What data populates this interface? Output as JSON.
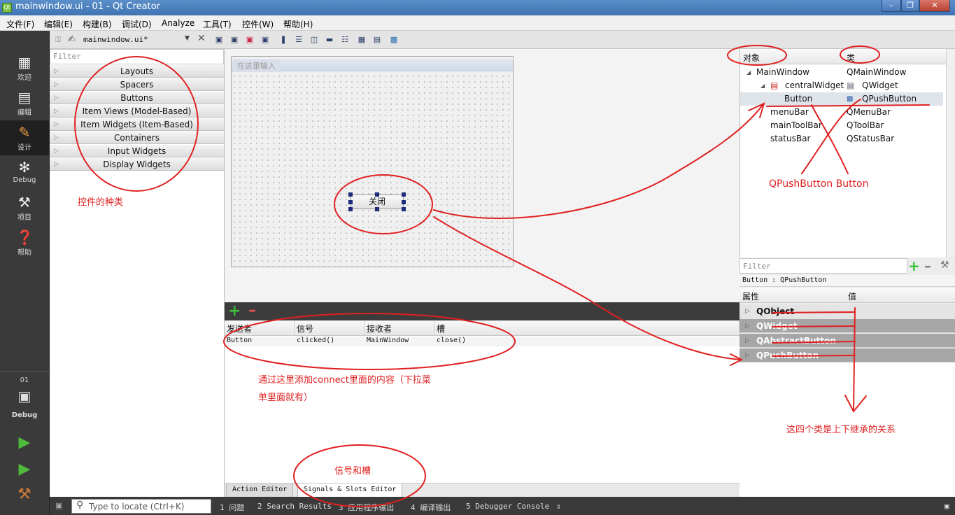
{
  "window": {
    "title": "mainwindow.ui - 01 - Qt Creator",
    "app_icon": "Qt"
  },
  "menubar": [
    "文件(F)",
    "编辑(E)",
    "构建(B)",
    "调试(D)",
    "Analyze",
    "工具(T)",
    "控件(W)",
    "帮助(H)"
  ],
  "modes": [
    {
      "label": "欢迎",
      "icon": "grid-icon"
    },
    {
      "label": "编辑",
      "icon": "document-icon"
    },
    {
      "label": "设计",
      "icon": "pencil-icon"
    },
    {
      "label": "Debug",
      "icon": "bug-icon"
    },
    {
      "label": "项目",
      "icon": "wrench-icon"
    },
    {
      "label": "帮助",
      "icon": "help-icon"
    }
  ],
  "kit": {
    "project": "01",
    "build": "Debug"
  },
  "editor": {
    "filename": "mainwindow.ui*"
  },
  "widgetbox": {
    "filter_placeholder": "Filter",
    "categories": [
      "Layouts",
      "Spacers",
      "Buttons",
      "Item Views (Model-Based)",
      "Item Widgets (Item-Based)",
      "Containers",
      "Input Widgets",
      "Display Widgets"
    ]
  },
  "form": {
    "toolbar_placeholder": "在这里输入",
    "button_text": "关闭"
  },
  "signals": {
    "headers": [
      "发送者",
      "信号",
      "接收者",
      "槽"
    ],
    "rows": [
      [
        "Button",
        "clicked()",
        "MainWindow",
        "close()"
      ]
    ]
  },
  "bottom_tabs": [
    "Action Editor",
    "Signals & Slots Editor"
  ],
  "object_inspector": {
    "headers": [
      "对象",
      "类"
    ],
    "rows": [
      {
        "object": "MainWindow",
        "class": "QMainWindow"
      },
      {
        "object": "centralWidget",
        "class": "QWidget"
      },
      {
        "object": "Button",
        "class": "QPushButton"
      },
      {
        "object": "menuBar",
        "class": "QMenuBar"
      },
      {
        "object": "mainToolBar",
        "class": "QToolBar"
      },
      {
        "object": "statusBar",
        "class": "QStatusBar"
      }
    ]
  },
  "property_editor": {
    "filter_placeholder": "Filter",
    "class_line": "Button : QPushButton",
    "headers": [
      "属性",
      "值"
    ],
    "groups": [
      "QObject",
      "QWidget",
      "QAbstractButton",
      "QPushButton"
    ]
  },
  "statusbar": {
    "locator_placeholder": "Type to locate (Ctrl+K)",
    "panes": [
      "1 问题",
      "2 Search Results",
      "3 应用程序输出",
      "4 编译输出",
      "5 Debugger Console"
    ]
  },
  "annotations": {
    "widget_kinds": "控件的种类",
    "qpushbutton_button": "QPushButton Button",
    "connect_line1": "通过这里添加connect里面的内容（下拉菜",
    "connect_line2": "单里面就有）",
    "signals_slots": "信号和槽",
    "inheritance": "这四个类是上下继承的关系",
    "ink_color": "#e02020"
  }
}
